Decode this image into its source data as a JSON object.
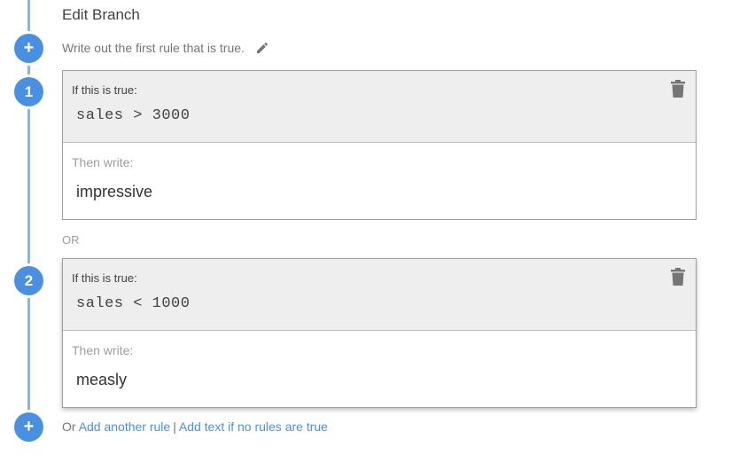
{
  "header": {
    "title": "Edit Branch",
    "subtitle": "Write out the first rule that is true."
  },
  "icons": {
    "edit": "pencil-icon",
    "delete": "trash-icon",
    "add": "plus-icon"
  },
  "colors": {
    "accent": "#4a90e2",
    "timeline": "#8ab4e8",
    "condition_bg": "#eeeeee"
  },
  "add_symbol": "+",
  "rules": [
    {
      "number": "1",
      "condition_label": "If this is true:",
      "condition": "sales > 3000",
      "then_label": "Then write:",
      "then_text": "impressive"
    },
    {
      "number": "2",
      "condition_label": "If this is true:",
      "condition": "sales < 1000",
      "then_label": "Then write:",
      "then_text": "measly"
    }
  ],
  "separator": "OR",
  "footer": {
    "prefix": "Or",
    "add_rule": "Add another rule",
    "divider": "|",
    "add_default": "Add text if no rules are true"
  }
}
